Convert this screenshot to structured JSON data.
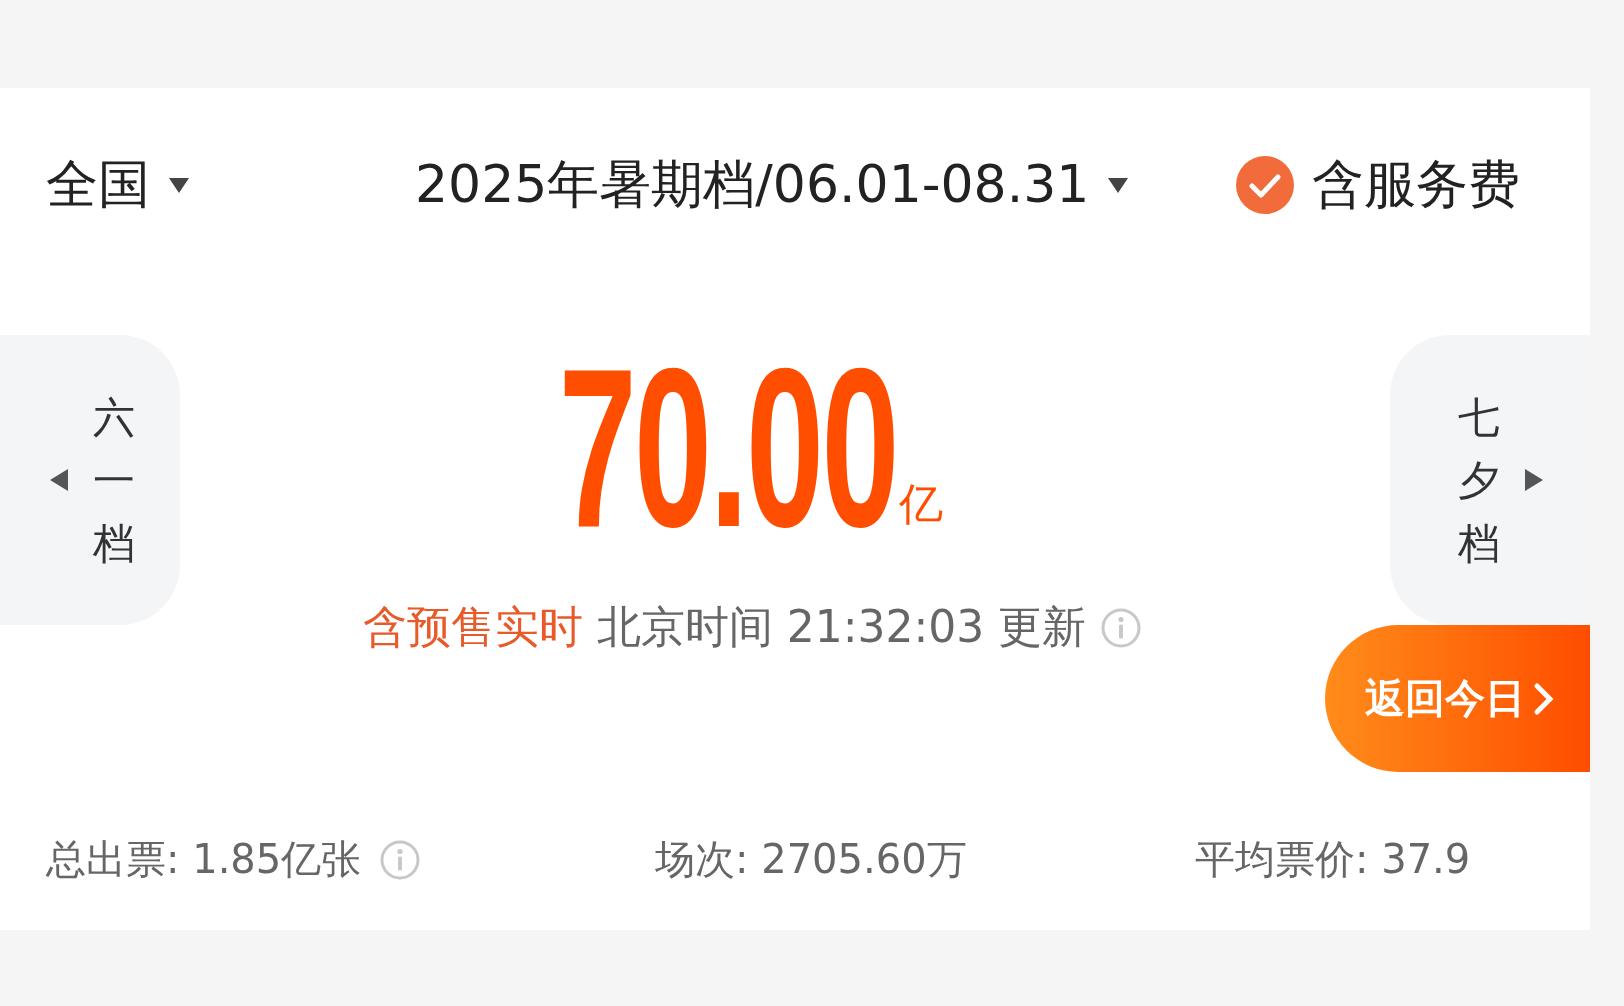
{
  "header": {
    "region": {
      "label": "全国"
    },
    "period": {
      "label": "2025年暑期档/06.01-08.31"
    },
    "service_fee": {
      "label": "含服务费",
      "checked": true
    }
  },
  "prev_period": {
    "label": "六一档"
  },
  "next_period": {
    "label": "七夕档"
  },
  "total": {
    "value": "70.00",
    "unit": "亿"
  },
  "update": {
    "highlight": "含预售实时",
    "text": "北京时间 21:32:03 更新",
    "info": true
  },
  "return_button": {
    "label": "返回今日"
  },
  "stats": [
    {
      "text": "总出票: 1.85亿张",
      "info": true
    },
    {
      "text": "场次: 2705.60万",
      "info": false
    },
    {
      "text": "平均票价: 37.9",
      "info": false
    }
  ]
}
